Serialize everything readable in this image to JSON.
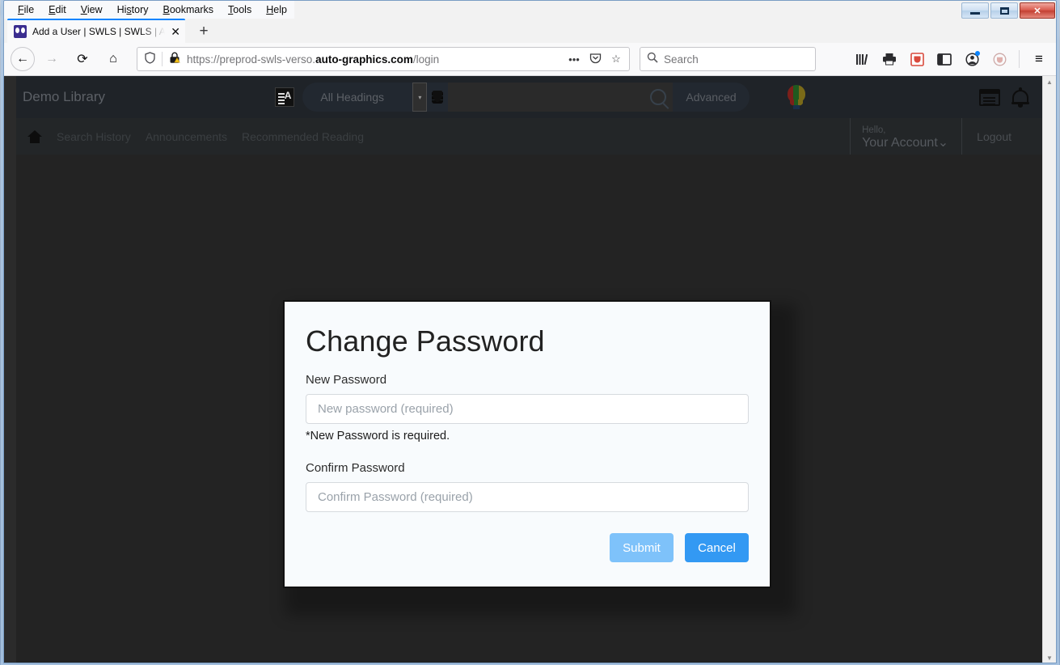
{
  "window": {
    "minimize_label": "Minimize",
    "maximize_label": "Maximize",
    "close_label": "✕"
  },
  "menubar": {
    "items": [
      "File",
      "Edit",
      "View",
      "History",
      "Bookmarks",
      "Tools",
      "Help"
    ]
  },
  "tabs": {
    "active": {
      "title": "Add a User | SWLS | SWLS | Auto",
      "close_label": "✕",
      "favicon": "swls-favicon"
    },
    "new_tab_label": "+"
  },
  "toolbar": {
    "back_label": "←",
    "forward_label": "→",
    "reload_label": "⟳",
    "home_label": "⌂",
    "url": {
      "prefix": "https://preprod-swls-verso.",
      "domain": "auto-graphics.com",
      "suffix": "/login",
      "shield_icon": "tracking-protection-shield-icon",
      "lock_icon": "insecure-lock-warning-icon",
      "page_actions_label": "•••",
      "pocket_label": "pocket-icon",
      "bookmark_label": "☆"
    },
    "search": {
      "placeholder": "Search",
      "icon": "search-icon"
    },
    "icons": [
      "library-icon",
      "print-icon",
      "pocket-extension-icon",
      "sidebar-icon",
      "account-icon",
      "pocket-save-icon"
    ],
    "menu_label": "≡"
  },
  "site": {
    "name": "Demo Library",
    "search": {
      "scope_value": "All Headings",
      "caret": "▾",
      "query": "",
      "advanced_label": "Advanced",
      "search_icon": "search-icon",
      "language_icon": "language-toggle-icon",
      "database_icon": "database-select-icon"
    },
    "header_icons": {
      "balloon": "hot-air-balloon-icon",
      "list": "my-lists-icon",
      "bell": "notifications-bell-icon"
    },
    "nav": {
      "home_icon": "home-icon",
      "links": [
        "Search History",
        "Announcements",
        "Recommended Reading"
      ]
    },
    "account": {
      "greeting": "Hello,",
      "name": "Your Account",
      "caret": "⌄",
      "logout_label": "Logout"
    }
  },
  "modal": {
    "title": "Change Password",
    "new_password": {
      "label": "New Password",
      "placeholder": "New password (required)",
      "value": "",
      "error": "*New Password is required."
    },
    "confirm_password": {
      "label": "Confirm Password",
      "placeholder": "Confirm Password (required)",
      "value": ""
    },
    "submit_label": "Submit",
    "cancel_label": "Cancel",
    "colors": {
      "submit_bg": "#7ec2fa",
      "cancel_bg": "#3399f3",
      "panel_bg": "#f8fbfd",
      "border": "#111111"
    }
  },
  "scrollbar": {
    "up_arrow": "▲",
    "down_arrow": "▼"
  }
}
